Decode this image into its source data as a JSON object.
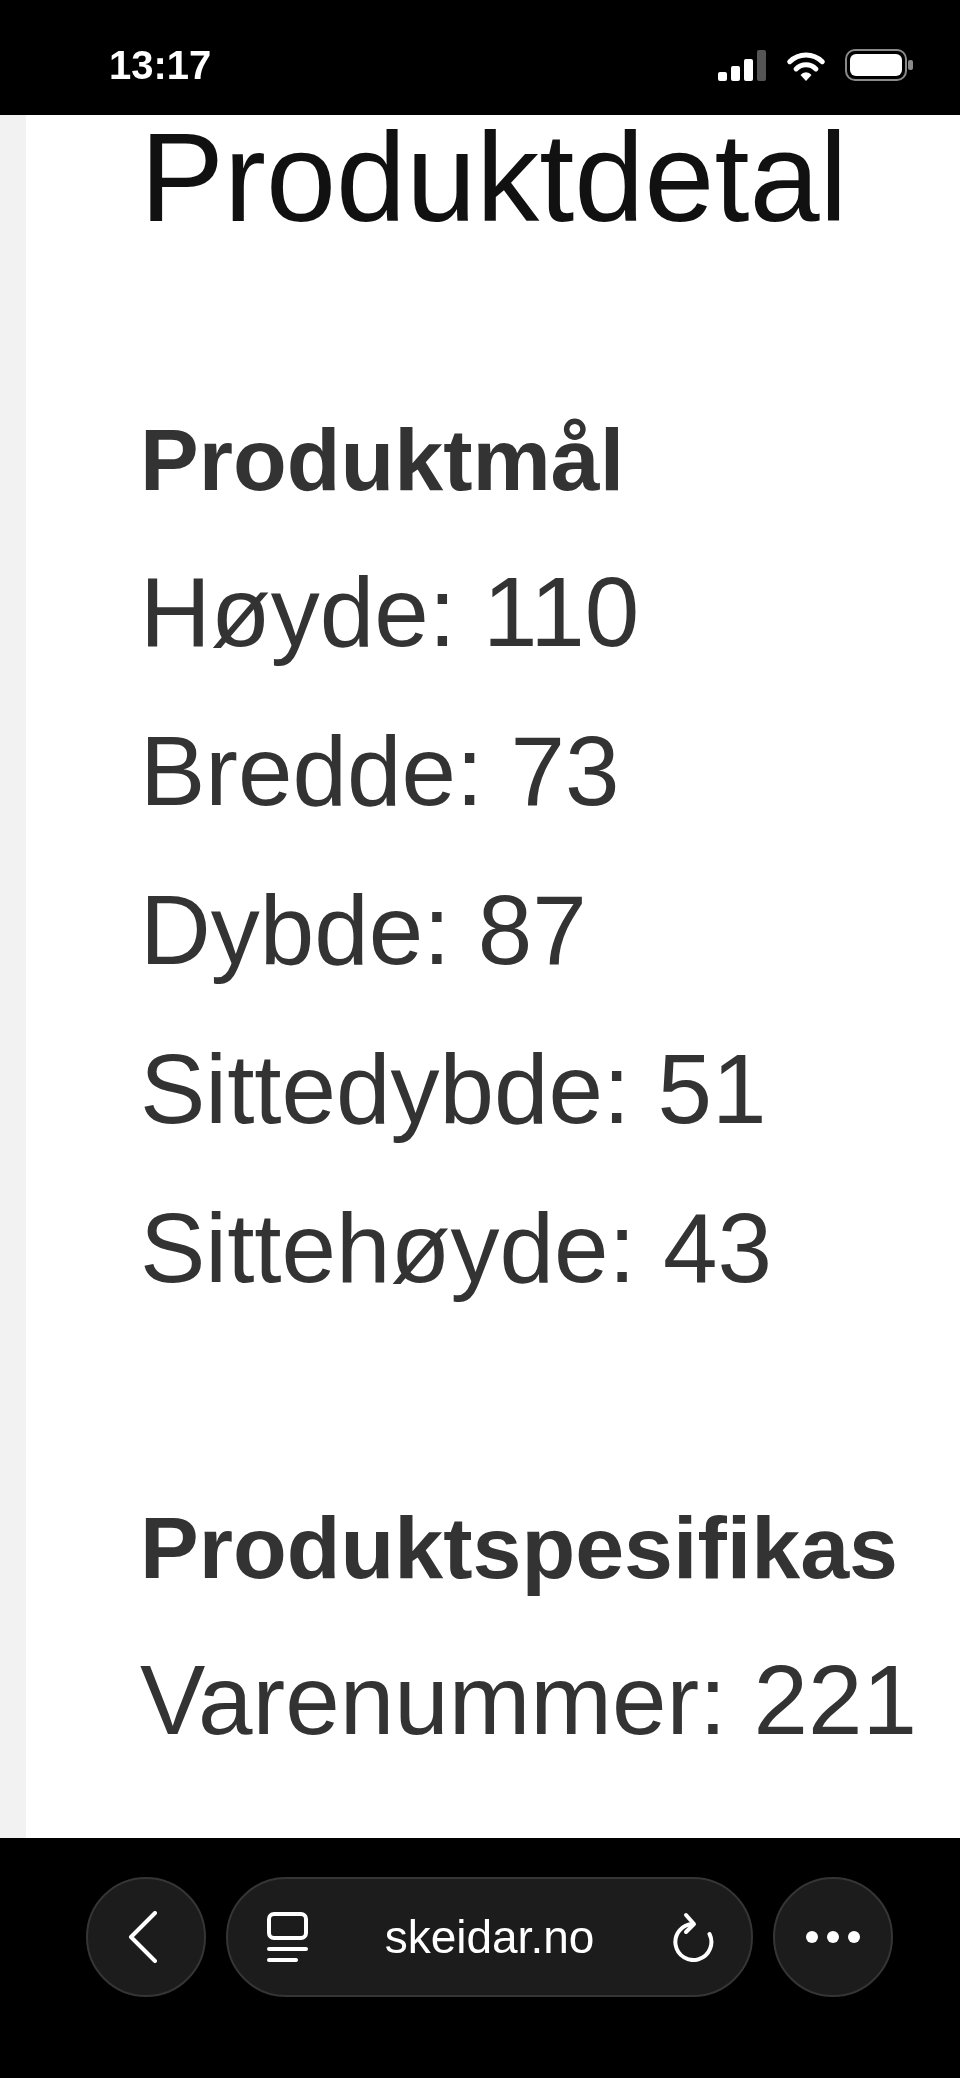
{
  "status_bar": {
    "time": "13:17"
  },
  "page": {
    "title": "Produktdetal",
    "sections": [
      {
        "heading": "Produktmål",
        "rows": [
          "Høyde: 110",
          "Bredde: 73",
          "Dybde: 87",
          "Sittedybde: 51",
          "Sittehøyde: 43"
        ]
      },
      {
        "heading": "Produktspesifikas",
        "rows": [
          "Varenummer: 221"
        ]
      }
    ]
  },
  "browser_bar": {
    "url": "skeidar.no"
  }
}
